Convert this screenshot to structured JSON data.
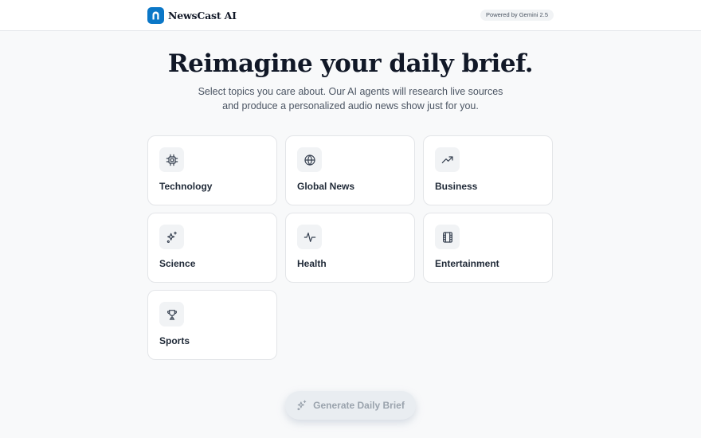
{
  "header": {
    "brand": "NewsCast AI",
    "powered_by": "Powered by Gemini 2.5"
  },
  "hero": {
    "title": "Reimagine your daily brief.",
    "subtitle": "Select topics you care about. Our AI agents will research live sources and produce a personalized audio news show just for you."
  },
  "topics": [
    {
      "label": "Technology",
      "icon": "cpu-chip-icon"
    },
    {
      "label": "Global News",
      "icon": "globe-icon"
    },
    {
      "label": "Business",
      "icon": "trending-up-icon"
    },
    {
      "label": "Science",
      "icon": "sparkles-icon"
    },
    {
      "label": "Health",
      "icon": "pulse-icon"
    },
    {
      "label": "Entertainment",
      "icon": "film-icon"
    },
    {
      "label": "Sports",
      "icon": "trophy-icon"
    }
  ],
  "action": {
    "generate_label": "Generate Daily Brief",
    "icon": "sparkles-icon"
  },
  "colors": {
    "brand": "#0b77c7",
    "background": "#f8f9fa",
    "button_disabled_bg": "#e9edf1",
    "button_disabled_text": "#9aa3ad"
  }
}
